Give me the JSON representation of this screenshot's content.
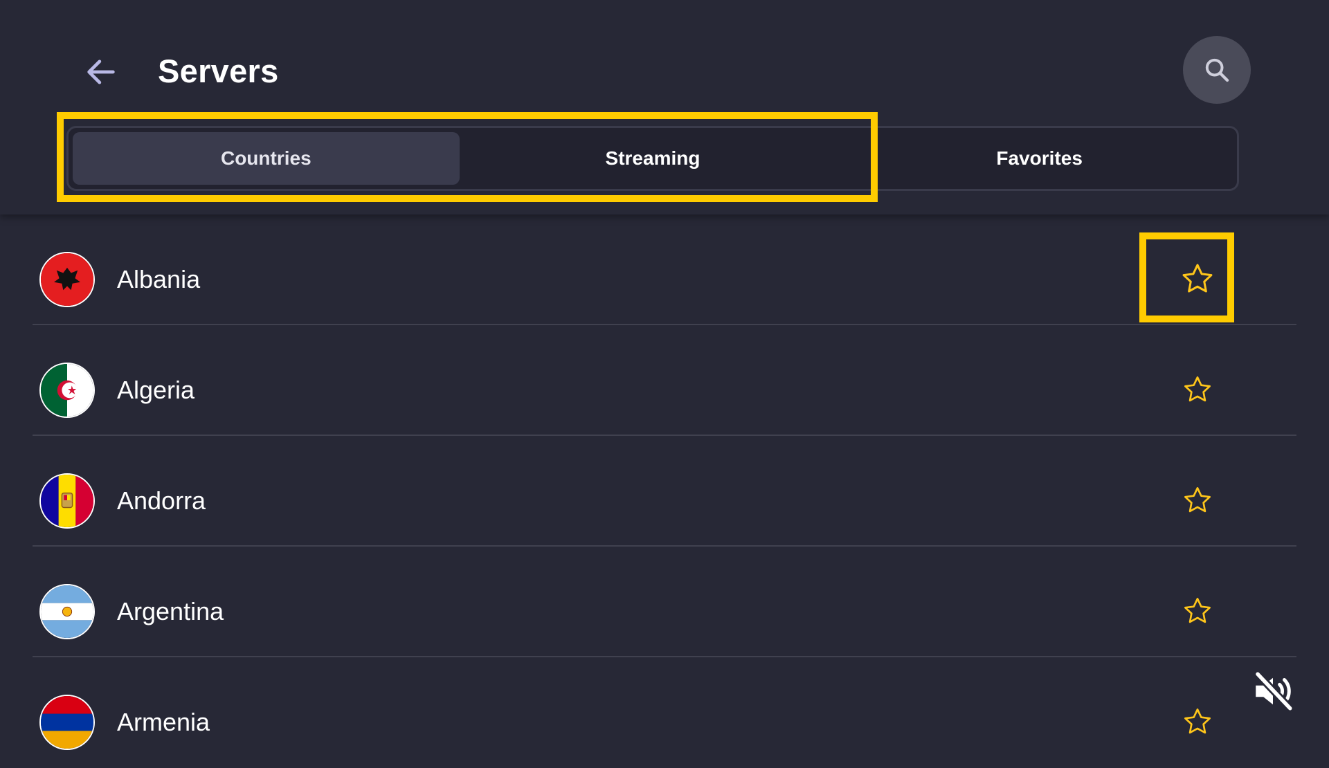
{
  "header": {
    "title": "Servers"
  },
  "tabs": [
    {
      "label": "Countries",
      "active": true
    },
    {
      "label": "Streaming",
      "active": false
    },
    {
      "label": "Favorites",
      "active": false
    }
  ],
  "countries": [
    {
      "name": "Albania"
    },
    {
      "name": "Algeria"
    },
    {
      "name": "Andorra"
    },
    {
      "name": "Argentina"
    },
    {
      "name": "Armenia"
    }
  ],
  "colors": {
    "background": "#272836",
    "highlight": "#ffcc00",
    "star": "#ffc61a",
    "search_button": "#4a4b59",
    "active_tab": "#3a3b4d"
  },
  "icons": {
    "back": "arrow-left-icon",
    "search": "search-icon",
    "favorite": "star-outline-icon",
    "mute": "volume-mute-icon"
  }
}
